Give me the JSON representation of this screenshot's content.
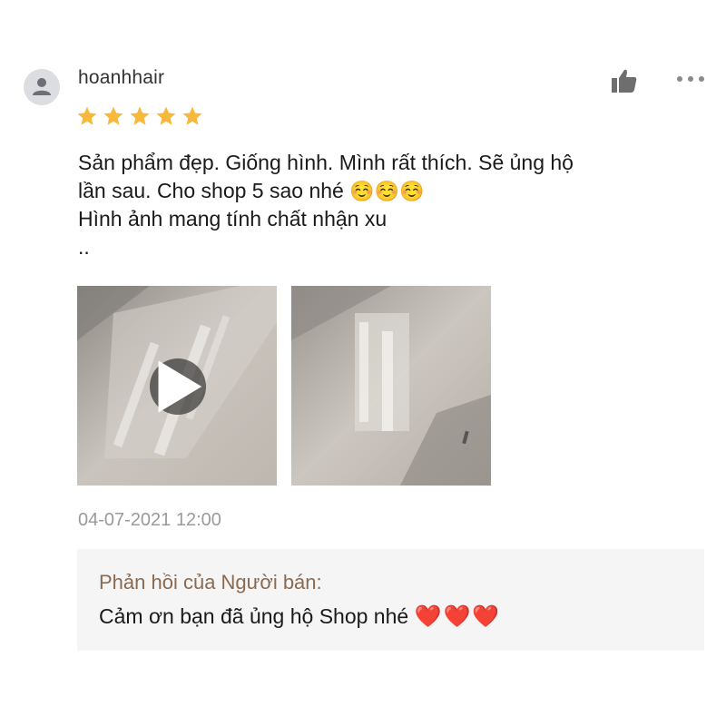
{
  "review": {
    "username": "hoanhhair",
    "rating": 5,
    "text_lines": [
      "Sản phẩm đẹp. Giống hình. Mình rất thích. Sẽ ủng hộ",
      "lần sau. Cho shop 5 sao nhé ",
      "Hình ảnh mang tính chất nhận xu",
      ".."
    ],
    "emoji_line2": "☺️☺️☺️",
    "timestamp": "04-07-2021 12:00",
    "media": [
      {
        "type": "video",
        "icon": "play-icon"
      },
      {
        "type": "image",
        "icon": "photo"
      }
    ]
  },
  "reply": {
    "title": "Phản hồi của Người bán:",
    "text": "Cảm ơn bạn đã ủng hộ Shop nhé ",
    "hearts": "❤️❤️❤️"
  },
  "colors": {
    "star": "#f6b93b",
    "reply_title": "#8a6a50",
    "reply_bg": "#f5f5f5",
    "timestamp": "#9a9a9a"
  },
  "icons": {
    "like": "thumbs-up-icon",
    "more": "more-dots-icon",
    "avatar": "user-avatar-icon"
  }
}
